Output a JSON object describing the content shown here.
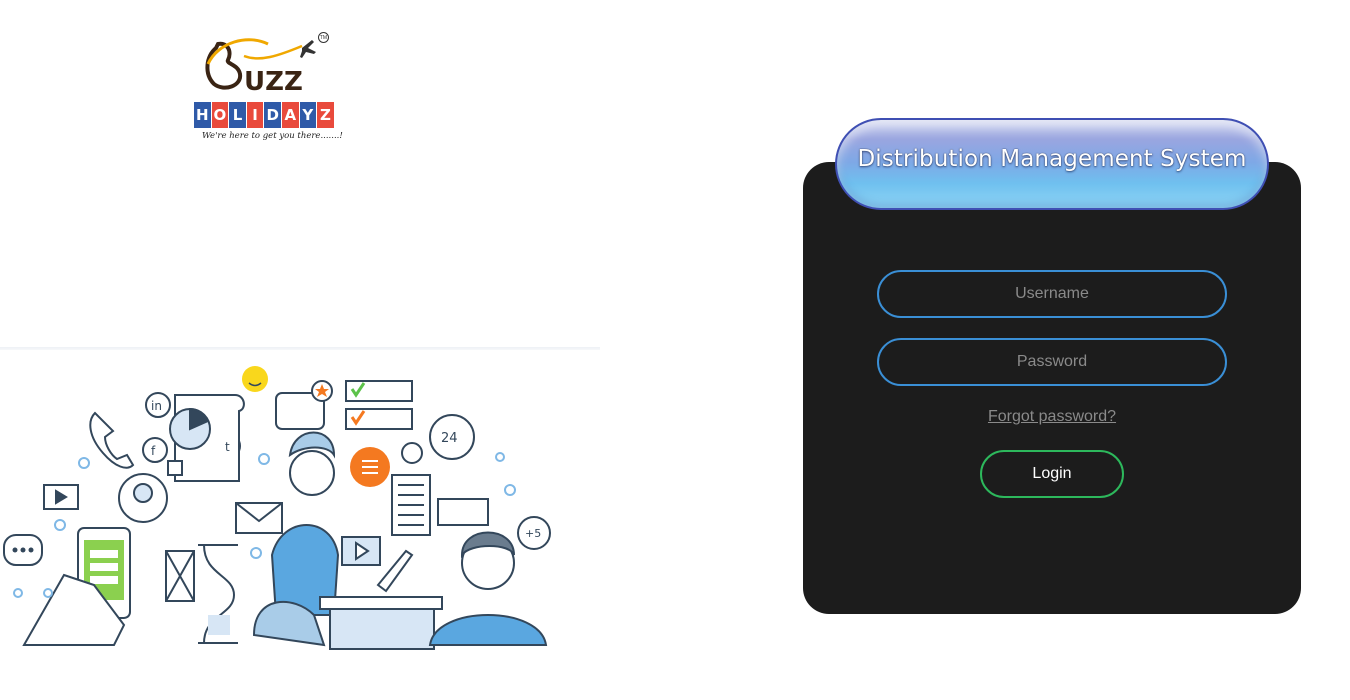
{
  "brand": {
    "buzz_text": "B",
    "buzz_rest": "UZZ",
    "holidayz_letters": [
      "H",
      "O",
      "L",
      "I",
      "D",
      "A",
      "Y",
      "Z"
    ],
    "holidayz_colors": [
      "#2f5aa8",
      "#e94a3c",
      "#2f5aa8",
      "#e94a3c",
      "#2f5aa8",
      "#e94a3c",
      "#2f5aa8",
      "#e94a3c"
    ],
    "tagline": "We're here to get you there.......!",
    "tm": "TM"
  },
  "illustration": {
    "clock_label": "24",
    "plus_badge": "+5",
    "social_in": "in",
    "social_f": "f",
    "social_t": "t"
  },
  "login_panel": {
    "title": "Distribution Management System",
    "username_placeholder": "Username",
    "password_placeholder": "Password",
    "forgot_label": "Forgot password?",
    "login_label": "Login"
  },
  "colors": {
    "panel_bg": "#1c1c1c",
    "field_border": "#3a8fd6",
    "login_border": "#2db85c"
  }
}
